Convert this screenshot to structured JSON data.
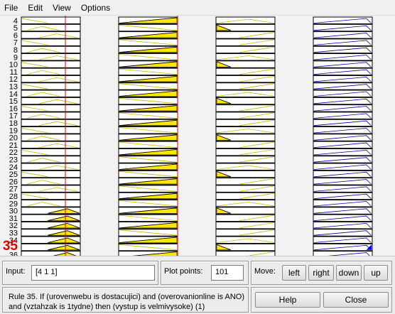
{
  "menu": {
    "file": "File",
    "edit": "Edit",
    "view": "View",
    "options": "Options"
  },
  "rules": {
    "numbers": [
      "4",
      "5",
      "6",
      "7",
      "8",
      "9",
      "10",
      "11",
      "12",
      "13",
      "14",
      "15",
      "16",
      "17",
      "18",
      "19",
      "20",
      "21",
      "22",
      "23",
      "24",
      "25",
      "26",
      "27",
      "28",
      "29",
      "30",
      "31",
      "32",
      "33",
      "34",
      "35",
      "36"
    ],
    "active": "35"
  },
  "colors": {
    "mf_fill": "#ffe600",
    "output_fill": "#0000ff",
    "marker": "#e00000",
    "output_line": "#0000a0"
  },
  "controls": {
    "input_label": "Input:",
    "input_value": "[4 1 1]",
    "plot_points_label": "Plot points:",
    "plot_points_value": "101",
    "move_label": "Move:",
    "left": "left",
    "right": "right",
    "down": "down",
    "up": "up",
    "help": "Help",
    "close": "Close"
  },
  "status": {
    "rule_text": "Rule 35. If (urovenwebu is dostacujici) and (overovanionline is ANO) and (vztahzak is 1tydne) then (vystup is velmivysoke) (1)"
  }
}
